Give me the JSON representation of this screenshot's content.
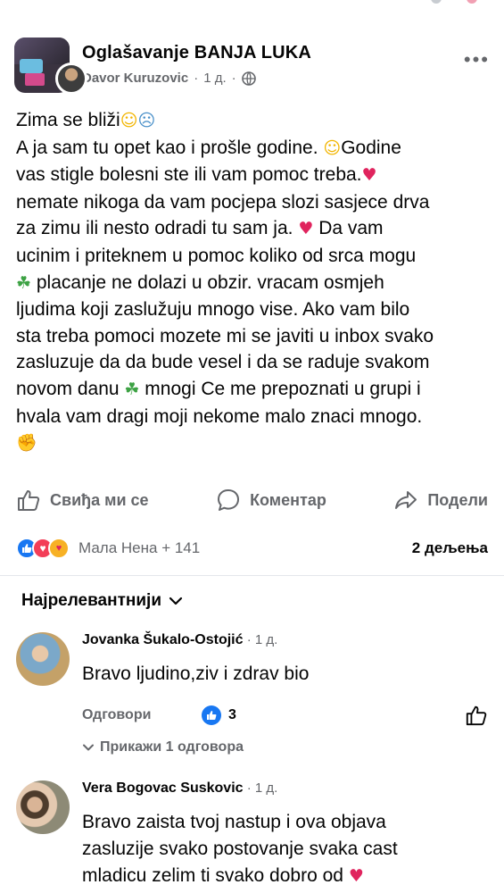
{
  "post": {
    "group_name": "Oglašavanje BANJA LUKA",
    "author": "Davor Kuruzovic",
    "time": "1 д.",
    "separator": "·",
    "body": {
      "l1": "Zima se bliži",
      "l2a": "A ja sam tu opet kao i prošle godine. ",
      "l2b": "Godine",
      "l3": "vas stigle  bolesni ste ili vam pomoc treba.",
      "l4": "nemate nikoga da vam pocjepa slozi sasjece drva",
      "l5a": "za zimu ili nesto odradi tu sam ja. ",
      "l5b": " Da vam",
      "l6": "ucinim i priteknem u pomoc koliko od srca mogu",
      "l7": "   placanje ne dolazi u obzir.  vracam osmjeh",
      "l8": "ljudima koji zaslužuju mnogo vise. Ako vam bilo",
      "l9": "sta treba pomoci mozete mi se javiti u inbox svako",
      "l10": "zasluzuje da da bude vesel i da se raduje svakom",
      "l11a": "novom danu ",
      "l11b": " mnogi Ce me prepoznati u grupi i",
      "l12": "hvala vam dragi moji  nekome malo znaci mnogo."
    },
    "emoji": {
      "blush": "☺",
      "cold": "☹",
      "smile": "☺",
      "heart": "♥",
      "clover": "☘",
      "arm": "✊"
    }
  },
  "actions": {
    "like": "Свиђа ми се",
    "comment": "Коментар",
    "share": "Подели"
  },
  "reactions": {
    "names": "Мала Нена + 141",
    "shares": "2 дељења"
  },
  "sort": {
    "label": "Најрелевантнији"
  },
  "comments": [
    {
      "name": "Jovanka Šukalo-Ostojić",
      "time": "1 д.",
      "text": "Bravo ljudino,ziv i zdrav bio",
      "reply_label": "Одговори",
      "like_count": "3",
      "replies_label": "Прикажи 1 одговора"
    },
    {
      "name": "Vera Bogovac Suskovic",
      "time": "1 д.",
      "line1": "Bravo  zaista  tvoj nastup i ova objava",
      "line2": "zasluzije svako postovanje   svaka cast",
      "line3": "mladicu zelim ti svako dobro od "
    }
  ],
  "colors": {
    "text": "#050505",
    "secondary": "#65676b",
    "like_blue": "#1877f2",
    "love_red": "#f33e58",
    "care_yellow": "#f7b125"
  }
}
